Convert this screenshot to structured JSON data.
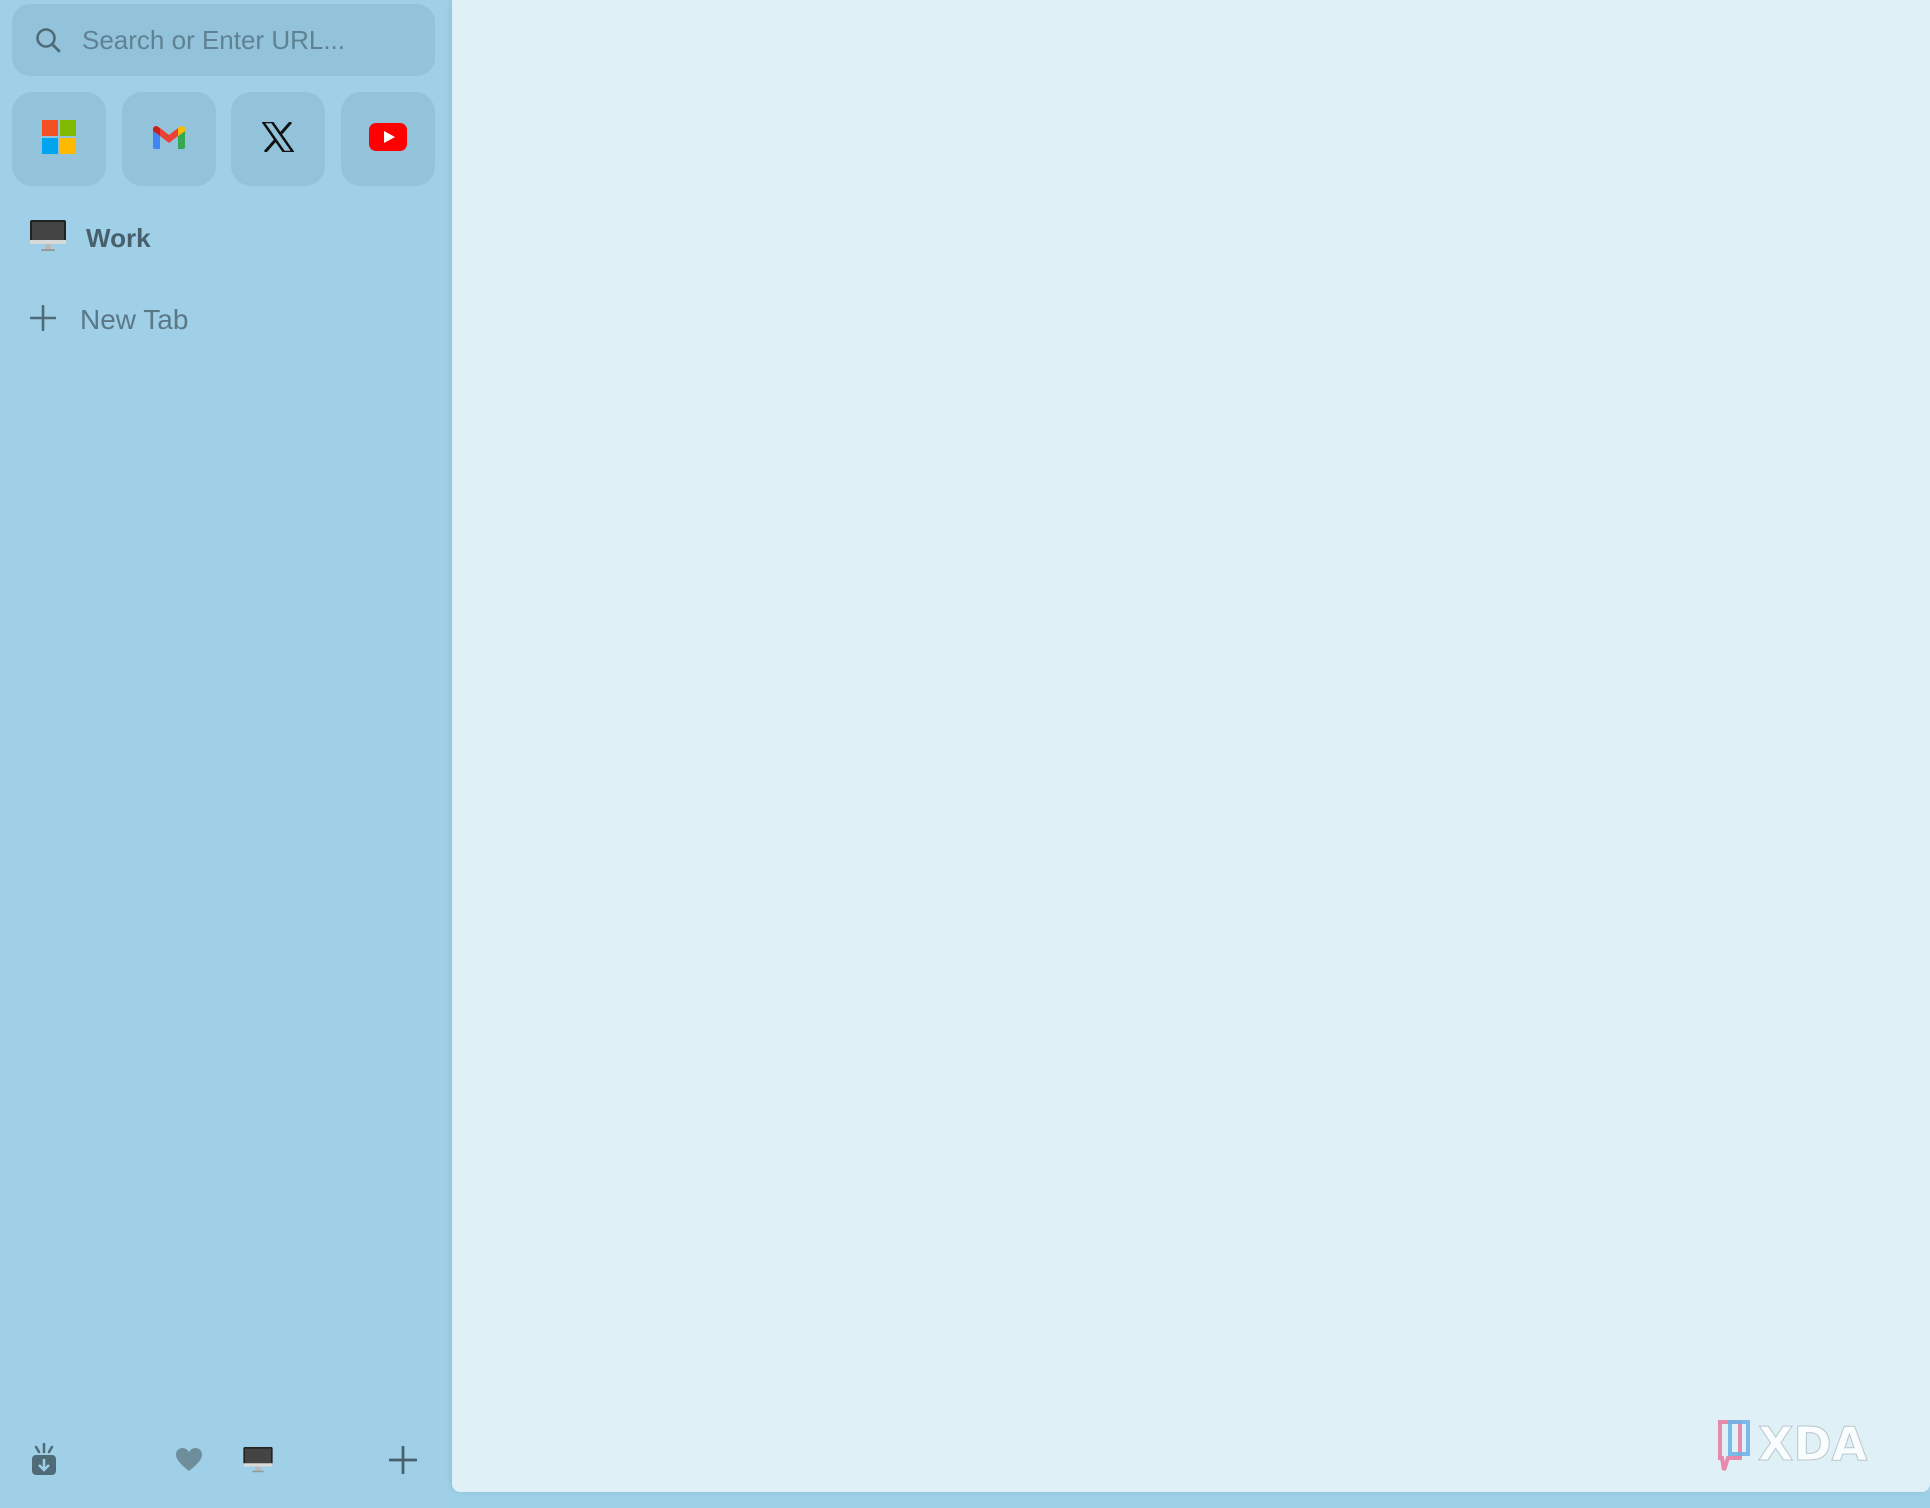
{
  "search": {
    "placeholder": "Search or Enter URL..."
  },
  "pinned_sites": [
    {
      "name": "Microsoft",
      "icon": "microsoft-logo-icon"
    },
    {
      "name": "Gmail",
      "icon": "gmail-logo-icon"
    },
    {
      "name": "X",
      "icon": "x-logo-icon"
    },
    {
      "name": "YouTube",
      "icon": "youtube-logo-icon"
    }
  ],
  "space": {
    "label": "Work",
    "icon": "desktop-computer-icon"
  },
  "new_tab": {
    "label": "New Tab",
    "icon": "plus-icon"
  },
  "bottom_bar": {
    "icons": [
      "downloads-icon",
      "heart-icon",
      "desktop-computer-icon",
      "plus-icon"
    ]
  },
  "watermark": {
    "text": "XDA"
  },
  "colors": {
    "sidebar_bg": "#9fd0e7",
    "content_bg": "#dff0f7",
    "youtube_red": "#ff0000",
    "text_dark": "#47606c"
  }
}
